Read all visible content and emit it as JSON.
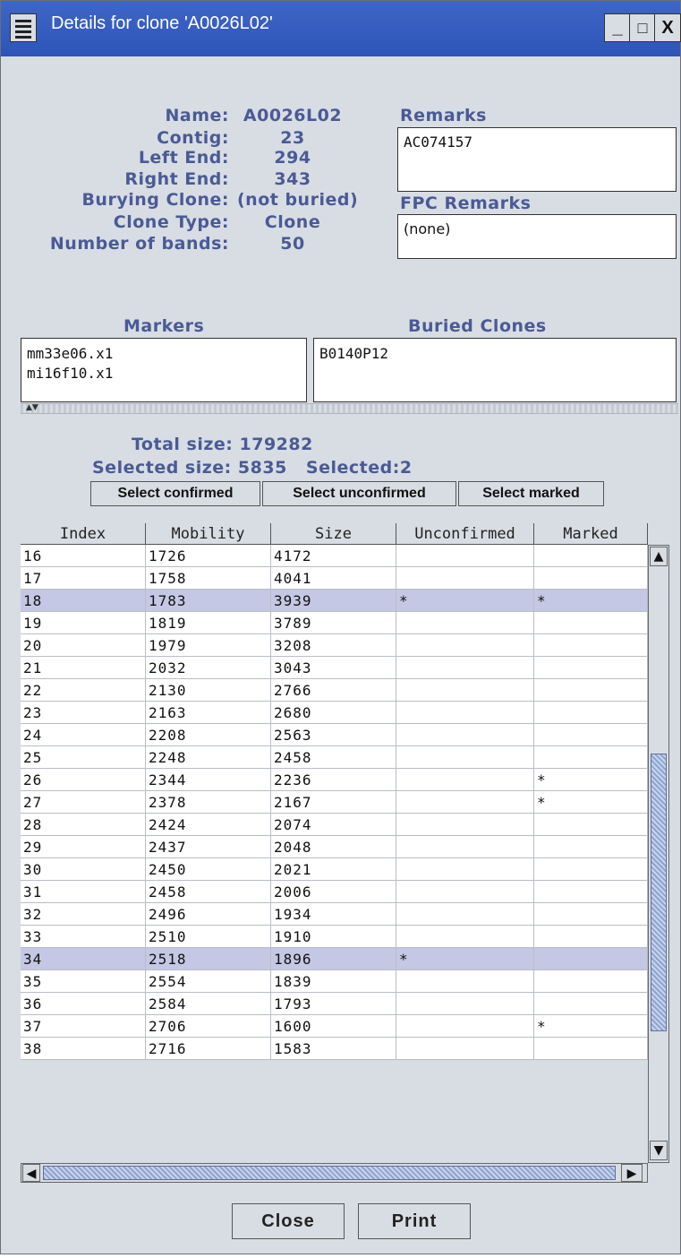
{
  "window": {
    "title": "Details for clone 'A0026L02'",
    "minimize": "_",
    "maximize": "□",
    "close": "X"
  },
  "details": {
    "labels": [
      "Name:",
      "Contig:",
      "Left End:",
      "Right End:",
      "Burying Clone:",
      "Clone Type:",
      "Number of bands:"
    ],
    "values": [
      "A0026L02",
      "23",
      "294",
      "343",
      "(not buried)",
      "Clone",
      "50"
    ]
  },
  "remarks": {
    "label": "Remarks",
    "value": "AC074157"
  },
  "fpc_remarks": {
    "label": "FPC Remarks",
    "value": "(none)"
  },
  "markers": {
    "label": "Markers",
    "items": [
      "mm33e06.x1",
      "mi16f10.x1"
    ]
  },
  "buried_clones": {
    "label": "Buried Clones",
    "items": [
      "B0140P12"
    ]
  },
  "summary": {
    "total_size_label": "Total size:",
    "total_size": "179282",
    "selected_size_label": "Selected size:",
    "selected_size": "5835",
    "selected_label": "Selected:",
    "selected": "2"
  },
  "buttons": {
    "select_confirmed": "Select confirmed",
    "select_unconfirmed": "Select unconfirmed",
    "select_marked": "Select marked",
    "close": "Close",
    "print": "Print"
  },
  "table": {
    "columns": [
      "Index",
      "Mobility",
      "Size",
      "Unconfirmed",
      "Marked"
    ],
    "rows": [
      [
        "16",
        "1726",
        "4172",
        "",
        ""
      ],
      [
        "17",
        "1758",
        "4041",
        "",
        ""
      ],
      [
        "18",
        "1783",
        "3939",
        "*",
        "*"
      ],
      [
        "19",
        "1819",
        "3789",
        "",
        ""
      ],
      [
        "20",
        "1979",
        "3208",
        "",
        ""
      ],
      [
        "21",
        "2032",
        "3043",
        "",
        ""
      ],
      [
        "22",
        "2130",
        "2766",
        "",
        ""
      ],
      [
        "23",
        "2163",
        "2680",
        "",
        ""
      ],
      [
        "24",
        "2208",
        "2563",
        "",
        ""
      ],
      [
        "25",
        "2248",
        "2458",
        "",
        ""
      ],
      [
        "26",
        "2344",
        "2236",
        "",
        "*"
      ],
      [
        "27",
        "2378",
        "2167",
        "",
        "*"
      ],
      [
        "28",
        "2424",
        "2074",
        "",
        ""
      ],
      [
        "29",
        "2437",
        "2048",
        "",
        ""
      ],
      [
        "30",
        "2450",
        "2021",
        "",
        ""
      ],
      [
        "31",
        "2458",
        "2006",
        "",
        ""
      ],
      [
        "32",
        "2496",
        "1934",
        "",
        ""
      ],
      [
        "33",
        "2510",
        "1910",
        "",
        ""
      ],
      [
        "34",
        "2518",
        "1896",
        "*",
        ""
      ],
      [
        "35",
        "2554",
        "1839",
        "",
        ""
      ],
      [
        "36",
        "2584",
        "1793",
        "",
        ""
      ],
      [
        "37",
        "2706",
        "1600",
        "",
        "*"
      ],
      [
        "38",
        "2716",
        "1583",
        "",
        ""
      ]
    ],
    "selected_rows": [
      "18",
      "34"
    ]
  },
  "scrollbar": {
    "up": "▲",
    "down": "▼",
    "left": "◀",
    "right": "▶"
  },
  "colors": {
    "titlebar": "#2d54b8",
    "label": "#4a5a96",
    "selected_row": "#c5c8e4",
    "background": "#d8dde3"
  }
}
